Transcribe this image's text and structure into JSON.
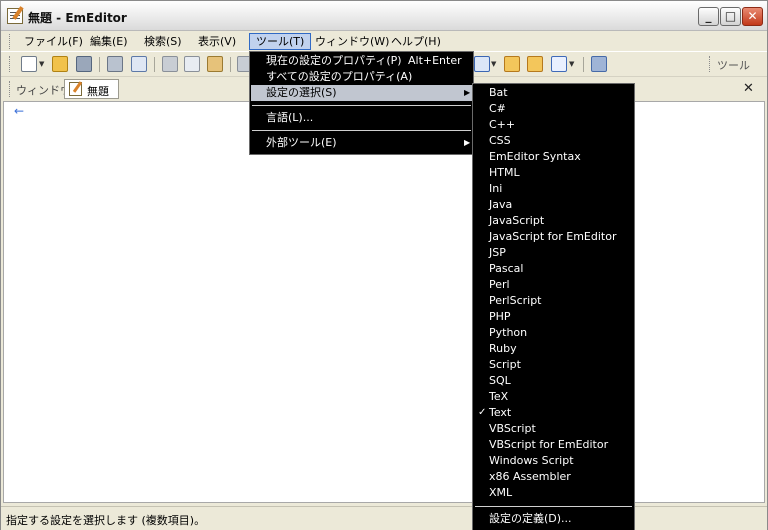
{
  "window": {
    "title": "無題 - EmEditor"
  },
  "menubar": {
    "items": [
      {
        "label": "ファイル(F)"
      },
      {
        "label": "編集(E)"
      },
      {
        "label": "検索(S)"
      },
      {
        "label": "表示(V)"
      },
      {
        "label": "ツール(T)"
      },
      {
        "label": "ウィンドウ(W)"
      },
      {
        "label": "ヘルプ(H)"
      }
    ]
  },
  "toolbar": {
    "tools_label": "ツール"
  },
  "tabbar": {
    "label": "ウィンドウ",
    "document_tab": "無題",
    "close_glyph": "✕"
  },
  "editor": {
    "eof_marker": "←"
  },
  "statusbar": {
    "text": "指定する設定を選択します (複数項目)。"
  },
  "tools_menu": {
    "items": [
      {
        "label": "現在の設定のプロパティ(P)",
        "shortcut": "Alt+Enter"
      },
      {
        "label": "すべての設定のプロパティ(A)"
      },
      {
        "label": "設定の選択(S)",
        "submenu_arrow": "▶"
      },
      {
        "label": "言語(L)..."
      },
      {
        "label": "外部ツール(E)",
        "submenu_arrow": "▶"
      }
    ]
  },
  "syntax_menu": {
    "items": [
      "Bat",
      "C#",
      "C++",
      "CSS",
      "EmEditor Syntax",
      "HTML",
      "Ini",
      "Java",
      "JavaScript",
      "JavaScript for EmEditor",
      "JSP",
      "Pascal",
      "Perl",
      "PerlScript",
      "PHP",
      "Python",
      "Ruby",
      "Script",
      "SQL",
      "TeX",
      "Text",
      "VBScript",
      "VBScript for EmEditor",
      "Windows Script",
      "x86 Assembler",
      "XML"
    ],
    "checked_item": "Text",
    "check_glyph": "✓",
    "define_label": "設定の定義(D)..."
  },
  "colors": {
    "menu_background": "#000000",
    "menu_highlight": "#c1c6d0",
    "menubar_active": "#c1d2ee",
    "close_button": "#c2391a"
  }
}
